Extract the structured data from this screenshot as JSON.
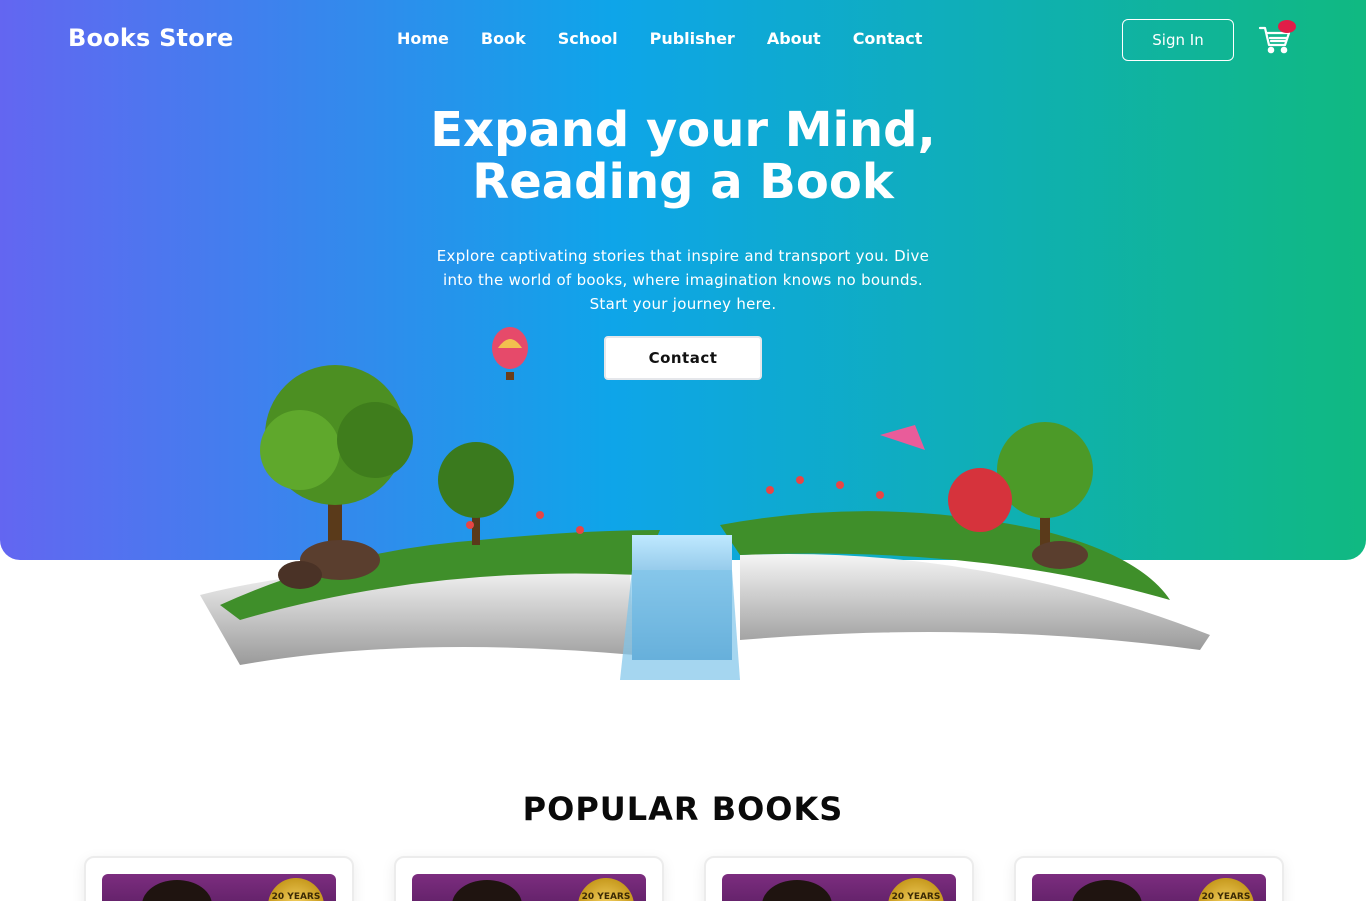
{
  "header": {
    "brand": "Books Store",
    "nav": [
      "Home",
      "Book",
      "School",
      "Publisher",
      "About",
      "Contact"
    ],
    "signin_label": "Sign In",
    "cart_icon": "cart-icon"
  },
  "hero": {
    "title_line1": "Expand your Mind,",
    "title_line2": "Reading a Book",
    "description": "Explore captivating stories that inspire and transport you. Dive into the world of books, where imagination knows no bounds. Start your journey here.",
    "cta_label": "Contact",
    "gradient": [
      "#6366f1",
      "#0ea5e9",
      "#10b981"
    ]
  },
  "popular": {
    "title": "POPULAR BOOKS",
    "cards": [
      {
        "seal_text": "20 YEARS"
      },
      {
        "seal_text": "20 YEARS"
      },
      {
        "seal_text": "20 YEARS"
      },
      {
        "seal_text": "20 YEARS"
      }
    ]
  }
}
